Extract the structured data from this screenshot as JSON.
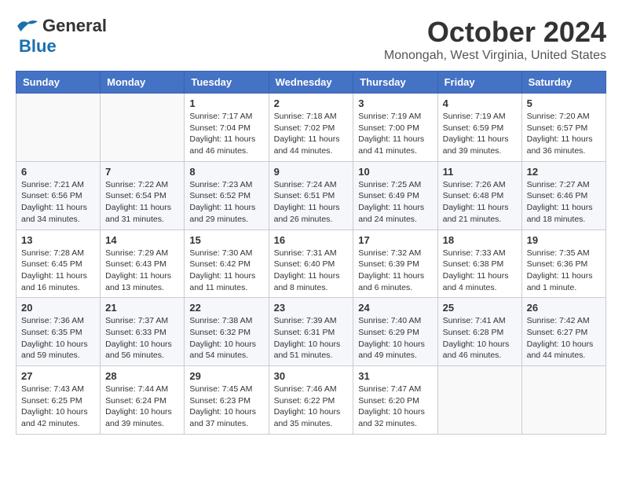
{
  "logo": {
    "line1": "General",
    "line2": "Blue"
  },
  "title": "October 2024",
  "subtitle": "Monongah, West Virginia, United States",
  "days_of_week": [
    "Sunday",
    "Monday",
    "Tuesday",
    "Wednesday",
    "Thursday",
    "Friday",
    "Saturday"
  ],
  "weeks": [
    [
      {
        "day": "",
        "sunrise": "",
        "sunset": "",
        "daylight": ""
      },
      {
        "day": "",
        "sunrise": "",
        "sunset": "",
        "daylight": ""
      },
      {
        "day": "1",
        "sunrise": "Sunrise: 7:17 AM",
        "sunset": "Sunset: 7:04 PM",
        "daylight": "Daylight: 11 hours and 46 minutes."
      },
      {
        "day": "2",
        "sunrise": "Sunrise: 7:18 AM",
        "sunset": "Sunset: 7:02 PM",
        "daylight": "Daylight: 11 hours and 44 minutes."
      },
      {
        "day": "3",
        "sunrise": "Sunrise: 7:19 AM",
        "sunset": "Sunset: 7:00 PM",
        "daylight": "Daylight: 11 hours and 41 minutes."
      },
      {
        "day": "4",
        "sunrise": "Sunrise: 7:19 AM",
        "sunset": "Sunset: 6:59 PM",
        "daylight": "Daylight: 11 hours and 39 minutes."
      },
      {
        "day": "5",
        "sunrise": "Sunrise: 7:20 AM",
        "sunset": "Sunset: 6:57 PM",
        "daylight": "Daylight: 11 hours and 36 minutes."
      }
    ],
    [
      {
        "day": "6",
        "sunrise": "Sunrise: 7:21 AM",
        "sunset": "Sunset: 6:56 PM",
        "daylight": "Daylight: 11 hours and 34 minutes."
      },
      {
        "day": "7",
        "sunrise": "Sunrise: 7:22 AM",
        "sunset": "Sunset: 6:54 PM",
        "daylight": "Daylight: 11 hours and 31 minutes."
      },
      {
        "day": "8",
        "sunrise": "Sunrise: 7:23 AM",
        "sunset": "Sunset: 6:52 PM",
        "daylight": "Daylight: 11 hours and 29 minutes."
      },
      {
        "day": "9",
        "sunrise": "Sunrise: 7:24 AM",
        "sunset": "Sunset: 6:51 PM",
        "daylight": "Daylight: 11 hours and 26 minutes."
      },
      {
        "day": "10",
        "sunrise": "Sunrise: 7:25 AM",
        "sunset": "Sunset: 6:49 PM",
        "daylight": "Daylight: 11 hours and 24 minutes."
      },
      {
        "day": "11",
        "sunrise": "Sunrise: 7:26 AM",
        "sunset": "Sunset: 6:48 PM",
        "daylight": "Daylight: 11 hours and 21 minutes."
      },
      {
        "day": "12",
        "sunrise": "Sunrise: 7:27 AM",
        "sunset": "Sunset: 6:46 PM",
        "daylight": "Daylight: 11 hours and 18 minutes."
      }
    ],
    [
      {
        "day": "13",
        "sunrise": "Sunrise: 7:28 AM",
        "sunset": "Sunset: 6:45 PM",
        "daylight": "Daylight: 11 hours and 16 minutes."
      },
      {
        "day": "14",
        "sunrise": "Sunrise: 7:29 AM",
        "sunset": "Sunset: 6:43 PM",
        "daylight": "Daylight: 11 hours and 13 minutes."
      },
      {
        "day": "15",
        "sunrise": "Sunrise: 7:30 AM",
        "sunset": "Sunset: 6:42 PM",
        "daylight": "Daylight: 11 hours and 11 minutes."
      },
      {
        "day": "16",
        "sunrise": "Sunrise: 7:31 AM",
        "sunset": "Sunset: 6:40 PM",
        "daylight": "Daylight: 11 hours and 8 minutes."
      },
      {
        "day": "17",
        "sunrise": "Sunrise: 7:32 AM",
        "sunset": "Sunset: 6:39 PM",
        "daylight": "Daylight: 11 hours and 6 minutes."
      },
      {
        "day": "18",
        "sunrise": "Sunrise: 7:33 AM",
        "sunset": "Sunset: 6:38 PM",
        "daylight": "Daylight: 11 hours and 4 minutes."
      },
      {
        "day": "19",
        "sunrise": "Sunrise: 7:35 AM",
        "sunset": "Sunset: 6:36 PM",
        "daylight": "Daylight: 11 hours and 1 minute."
      }
    ],
    [
      {
        "day": "20",
        "sunrise": "Sunrise: 7:36 AM",
        "sunset": "Sunset: 6:35 PM",
        "daylight": "Daylight: 10 hours and 59 minutes."
      },
      {
        "day": "21",
        "sunrise": "Sunrise: 7:37 AM",
        "sunset": "Sunset: 6:33 PM",
        "daylight": "Daylight: 10 hours and 56 minutes."
      },
      {
        "day": "22",
        "sunrise": "Sunrise: 7:38 AM",
        "sunset": "Sunset: 6:32 PM",
        "daylight": "Daylight: 10 hours and 54 minutes."
      },
      {
        "day": "23",
        "sunrise": "Sunrise: 7:39 AM",
        "sunset": "Sunset: 6:31 PM",
        "daylight": "Daylight: 10 hours and 51 minutes."
      },
      {
        "day": "24",
        "sunrise": "Sunrise: 7:40 AM",
        "sunset": "Sunset: 6:29 PM",
        "daylight": "Daylight: 10 hours and 49 minutes."
      },
      {
        "day": "25",
        "sunrise": "Sunrise: 7:41 AM",
        "sunset": "Sunset: 6:28 PM",
        "daylight": "Daylight: 10 hours and 46 minutes."
      },
      {
        "day": "26",
        "sunrise": "Sunrise: 7:42 AM",
        "sunset": "Sunset: 6:27 PM",
        "daylight": "Daylight: 10 hours and 44 minutes."
      }
    ],
    [
      {
        "day": "27",
        "sunrise": "Sunrise: 7:43 AM",
        "sunset": "Sunset: 6:25 PM",
        "daylight": "Daylight: 10 hours and 42 minutes."
      },
      {
        "day": "28",
        "sunrise": "Sunrise: 7:44 AM",
        "sunset": "Sunset: 6:24 PM",
        "daylight": "Daylight: 10 hours and 39 minutes."
      },
      {
        "day": "29",
        "sunrise": "Sunrise: 7:45 AM",
        "sunset": "Sunset: 6:23 PM",
        "daylight": "Daylight: 10 hours and 37 minutes."
      },
      {
        "day": "30",
        "sunrise": "Sunrise: 7:46 AM",
        "sunset": "Sunset: 6:22 PM",
        "daylight": "Daylight: 10 hours and 35 minutes."
      },
      {
        "day": "31",
        "sunrise": "Sunrise: 7:47 AM",
        "sunset": "Sunset: 6:20 PM",
        "daylight": "Daylight: 10 hours and 32 minutes."
      },
      {
        "day": "",
        "sunrise": "",
        "sunset": "",
        "daylight": ""
      },
      {
        "day": "",
        "sunrise": "",
        "sunset": "",
        "daylight": ""
      }
    ]
  ]
}
